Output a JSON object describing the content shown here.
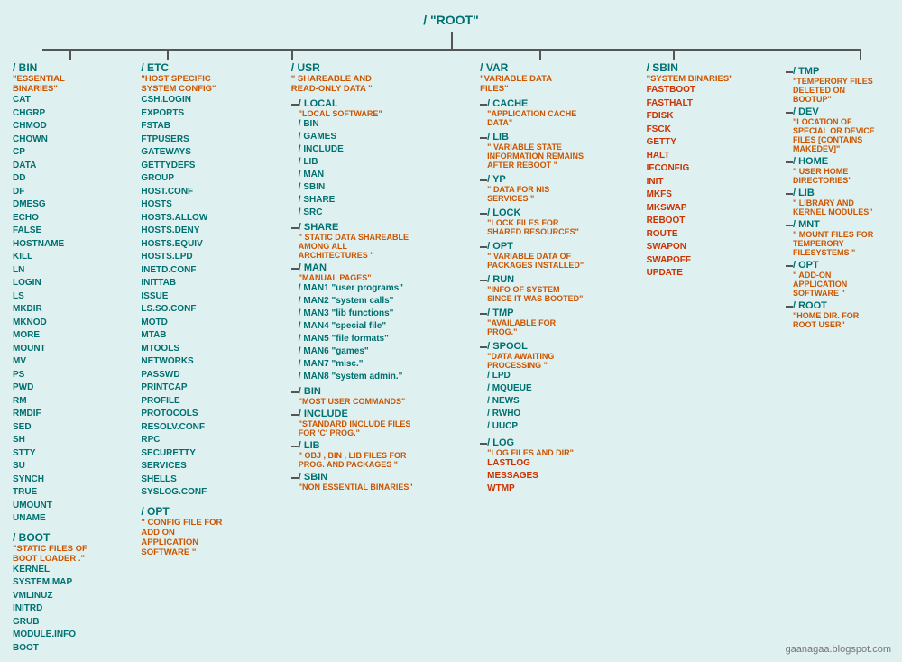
{
  "root": {
    "label": "/    \"ROOT\"",
    "description": ""
  },
  "bin": {
    "title": "/ BIN",
    "subtitle": "\"ESSENTIAL BINARIES\"",
    "files": [
      "CAT",
      "CHGRP",
      "CHMOD",
      "CHOWN",
      "CP",
      "DATA",
      "DD",
      "DF",
      "DMESG",
      "ECHO",
      "FALSE",
      "HOSTNAME",
      "KILL",
      "LN",
      "LOGIN",
      "LS",
      "MKDIR",
      "MKNOD",
      "MORE",
      "MOUNT",
      "MV",
      "PS",
      "PWD",
      "RM",
      "RMDIF",
      "SED",
      "SH",
      "STTY",
      "SU",
      "SYNCH",
      "TRUE",
      "UMOUNT",
      "UNAME"
    ]
  },
  "boot": {
    "title": "/ BOOT",
    "subtitle": "\"STATIC FILES OF BOOT LOADER .\"",
    "files": [
      "KERNEL",
      "SYSTEM.MAP",
      "VMLINUZ",
      "INITRD",
      "GRUB",
      "MODULE.INFO",
      "BOOT"
    ]
  },
  "etc": {
    "title": "/ ETC",
    "subtitle": "\"HOST SPECIFIC SYSTEM CONFIG\"",
    "files": [
      "CSH.LOGIN",
      "EXPORTS",
      "FSTAB",
      "FTPUSERS",
      "GATEWAYS",
      "GETTYDEFS",
      "GROUP",
      "HOST.CONF",
      "HOSTS",
      "HOSTS.ALLOW",
      "HOSTS.DENY",
      "HOSTS.EQUIV",
      "HOSTS.LPD",
      "INETD.CONF",
      "INITTAB",
      "ISSUE",
      "LS.SO.CONF",
      "MOTD",
      "MTAB",
      "MTOOLS",
      "NETWORKS",
      "PASSWD",
      "PRINTCAP",
      "PROFILE",
      "PROTOCOLS",
      "RESOLV.CONF",
      "RPC",
      "SECURETTY",
      "SERVICES",
      "SHELLS",
      "SYSLOG.CONF"
    ],
    "opt": {
      "title": "/ OPT",
      "subtitle": "\" CONFIG FILE FOR ADD ON APPLICATION SOFTWARE \""
    }
  },
  "usr": {
    "title": "/ USR",
    "subtitle": "\" SHAREABLE AND READ-ONLY DATA \"",
    "local": {
      "title": "/ LOCAL",
      "subtitle": "\"LOCAL SOFTWARE\"",
      "subdirs": [
        "/ BIN",
        "/ GAMES",
        "/ INCLUDE",
        "/ LIB",
        "/ MAN",
        "/ SBIN",
        "/ SHARE",
        "/ SRC"
      ]
    },
    "share": {
      "title": "/ SHARE",
      "subtitle": "\" STATIC DATA SHAREABLE AMONG ALL ARCHITECTURES \""
    },
    "man": {
      "title": "/ MAN",
      "subtitle": "\"MANUAL PAGES\"",
      "subdirs": [
        "/ MAN1 \"user programs\"",
        "/ MAN2 \"system calls\"",
        "/ MAN3 \"lib functions\"",
        "/ MAN4 \"special file\"",
        "/ MAN5 \"file formats\"",
        "/ MAN6 \"games\"",
        "/ MAN7 \"misc.\"",
        "/ MAN8 \"system admin.\""
      ]
    },
    "bin": {
      "title": "/ BIN",
      "subtitle": "\"MOST USER COMMANDS\""
    },
    "include": {
      "title": "/ INCLUDE",
      "subtitle": "\"STANDARD INCLUDE FILES FOR 'C' PROG.\""
    },
    "lib": {
      "title": "/ LIB",
      "subtitle": "\" OBJ , BIN , LIB FILES FOR PROG. AND PACKAGES \""
    },
    "sbin": {
      "title": "/ SBIN",
      "subtitle": "\"NON ESSENTIAL BINARIES\""
    }
  },
  "var": {
    "title": "/ VAR",
    "subtitle": "\"VARIABLE DATA FILES\"",
    "cache": {
      "title": "/ CACHE",
      "subtitle": "\"APPLICATION CACHE DATA\""
    },
    "lib": {
      "title": "/ LIB",
      "subtitle": "\" VARIABLE STATE INFORMATION REMAINS AFTER REBOOT \""
    },
    "yp": {
      "title": "/ YP",
      "subtitle": "\" DATA FOR NIS SERVICES \""
    },
    "lock": {
      "title": "/ LOCK",
      "subtitle": "\"LOCK FILES FOR SHARED RESOURCES\""
    },
    "opt": {
      "title": "/ OPT",
      "subtitle": "\" VARIABLE DATA OF PACKAGES INSTALLED\""
    },
    "run": {
      "title": "/ RUN",
      "subtitle": "\"INFO OF SYSTEM SINCE IT WAS BOOTED\""
    },
    "tmp": {
      "title": "/ TMP",
      "subtitle": "\"AVAILABLE FOR PROG.\""
    },
    "spool": {
      "title": "/ SPOOL",
      "subtitle": "\"DATA AWAITING PROCESSING \"",
      "subdirs": [
        "/ LPD",
        "/ MQUEUE",
        "/ NEWS",
        "/ RWHO",
        "/ UUCP"
      ]
    },
    "log": {
      "title": "/ LOG",
      "subtitle": "\"LOG FILES AND DIR\"",
      "files_orange": [
        "LASTLOG",
        "MESSAGES",
        "WTMP"
      ]
    }
  },
  "sbin": {
    "title": "/ SBIN",
    "subtitle": "\"SYSTEM BINARIES\"",
    "files_orange": [
      "FASTBOOT",
      "FASTHALT",
      "FDISK",
      "FSCK",
      "GETTY",
      "HALT",
      "IFCONFIG",
      "INIT",
      "MKFS",
      "MKSWAP",
      "REBOOT",
      "ROUTE",
      "SWAPON",
      "SWAPOFF",
      "UPDATE"
    ]
  },
  "right_col": {
    "tmp": {
      "title": "/ TMP",
      "subtitle": "\"TEMPERORY FILES DELETED ON BOOTUP\""
    },
    "dev": {
      "title": "/ DEV",
      "subtitle": "\"LOCATION OF SPECIAL OR DEVICE FILES [CONTAINS MAKEDEV]\""
    },
    "home": {
      "title": "/ HOME",
      "subtitle": "\" USER HOME DIRECTORIES\""
    },
    "lib": {
      "title": "/ LIB",
      "subtitle": "\"  LIBRARY AND KERNEL MODULES\""
    },
    "mnt": {
      "title": "/ MNT",
      "subtitle": "\"  MOUNT FILES FOR TEMPERORY FILESYSTEMS \""
    },
    "opt": {
      "title": "/ OPT",
      "subtitle": "\" ADD-ON APPLICATION SOFTWARE \""
    },
    "root_dir": {
      "title": "/ ROOT",
      "subtitle": "\"HOME DIR. FOR ROOT USER\""
    }
  },
  "watermark": "gaanagaa.blogspot.com"
}
